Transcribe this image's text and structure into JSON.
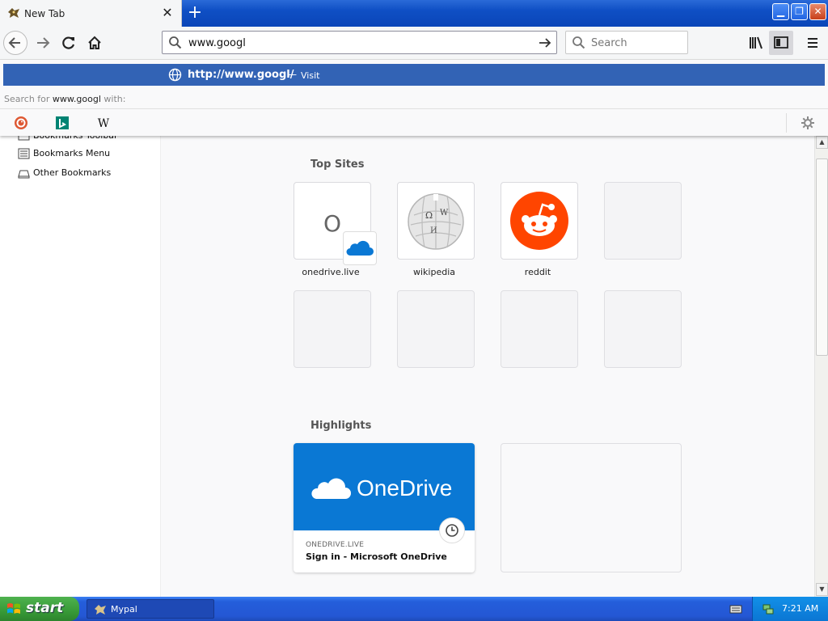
{
  "tab": {
    "title": "New Tab"
  },
  "toolbar": {
    "url_value": "www.googl",
    "search_placeholder": "Search"
  },
  "popup": {
    "suggestion_url": "http://www.googl/",
    "suggestion_sep": "—",
    "suggestion_action": "Visit",
    "search_for_prefix": "Search for",
    "search_for_term": "www.googl",
    "search_for_suffix": "with:",
    "engines": [
      "DuckDuckGo",
      "Bing",
      "Wikipedia"
    ]
  },
  "sidebar": {
    "items": [
      {
        "label": "Bookmarks Toolbar"
      },
      {
        "label": "Bookmarks Menu"
      },
      {
        "label": "Other Bookmarks"
      }
    ]
  },
  "top_sites": {
    "title": "Top Sites",
    "tiles": [
      {
        "label": "onedrive.live",
        "letter": "O"
      },
      {
        "label": "wikipedia"
      },
      {
        "label": "reddit"
      }
    ]
  },
  "highlights": {
    "title": "Highlights",
    "card": {
      "brand": "OneDrive",
      "site": "ONEDRIVE.LIVE",
      "title": "Sign in - Microsoft OneDrive"
    }
  },
  "taskbar": {
    "start_label": "start",
    "task_label": "Mypal",
    "clock": "7:21 AM"
  },
  "colors": {
    "selection_blue": "#3263b5",
    "onedrive_blue": "#0a78d4",
    "reddit_orange": "#ff4500",
    "xp_green": "#379a37"
  }
}
